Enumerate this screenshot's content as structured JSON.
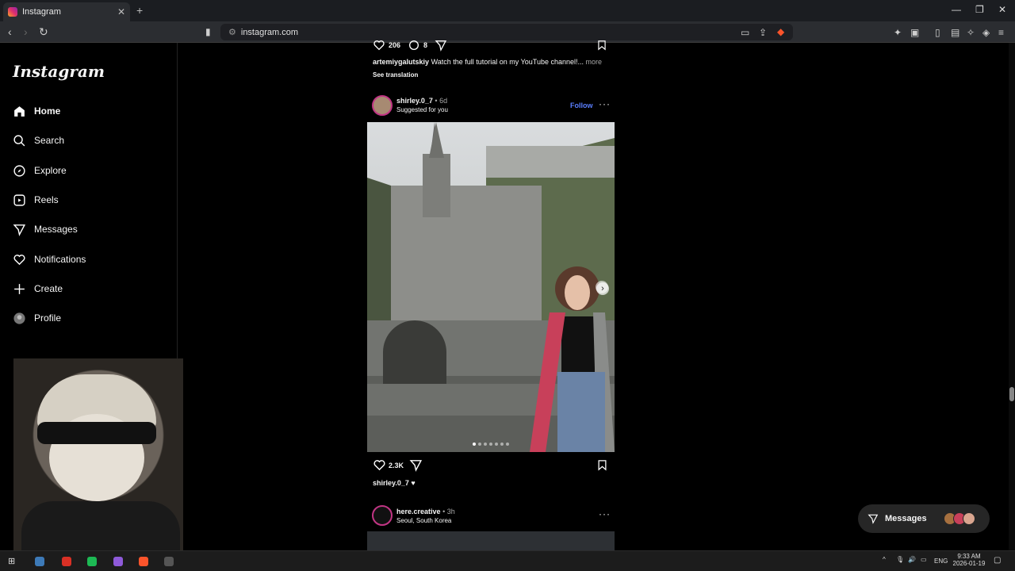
{
  "browser": {
    "tab_title": "Instagram",
    "url": "instagram.com"
  },
  "sidebar": {
    "logo": "Instagram",
    "items": [
      {
        "label": "Home",
        "icon": "home-icon"
      },
      {
        "label": "Search",
        "icon": "search-icon"
      },
      {
        "label": "Explore",
        "icon": "compass-icon"
      },
      {
        "label": "Reels",
        "icon": "reels-icon"
      },
      {
        "label": "Messages",
        "icon": "paper-plane-icon"
      },
      {
        "label": "Notifications",
        "icon": "heart-icon"
      },
      {
        "label": "Create",
        "icon": "plus-icon"
      },
      {
        "label": "Profile",
        "icon": "avatar-icon"
      }
    ]
  },
  "prev_post": {
    "likes": "206",
    "comments": "8",
    "caption_user": "artemiygalutskiy",
    "caption_text": "Watch the full tutorial on my YouTube channel!...",
    "more": "more",
    "see_translation": "See translation"
  },
  "post": {
    "username": "shirley.0_7",
    "separator": "•",
    "age": "6d",
    "subtitle": "Suggested for you",
    "follow": "Follow",
    "likes": "2.3K",
    "caption_user": "shirley.0_7",
    "caption_emoji": "♥",
    "carousel_count": 7,
    "carousel_active": 1
  },
  "next_post": {
    "username": "here.creative",
    "separator": "•",
    "age": "3h",
    "location": "Seoul, South Korea"
  },
  "messages_pill": {
    "label": "Messages"
  },
  "taskbar": {
    "language": "ENG",
    "time": "9:33 AM",
    "date": "2026-01-19"
  },
  "colors": {
    "accent_blue": "#5b7fff",
    "background": "#000000"
  }
}
